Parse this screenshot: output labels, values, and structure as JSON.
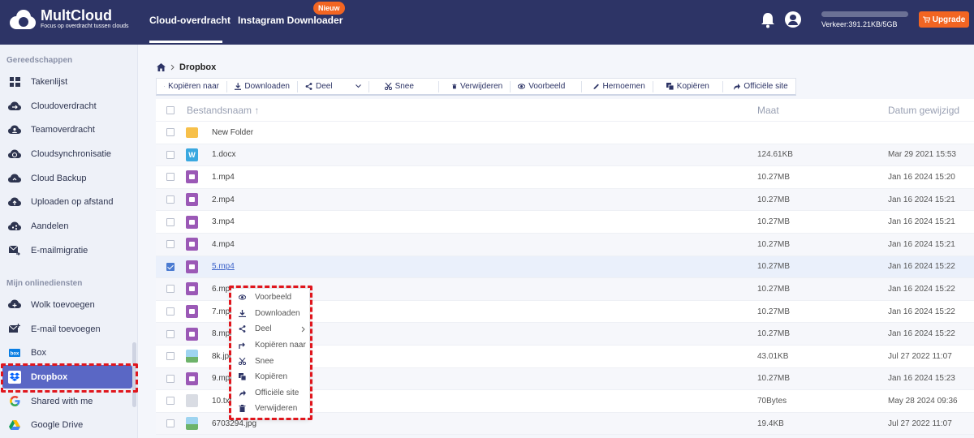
{
  "header": {
    "logo_name": "MultCloud",
    "logo_sub": "Focus op overdracht tussen clouds",
    "nav": [
      "Cloud-overdracht",
      "Instagram Downloader"
    ],
    "badge_new": "Nieuw",
    "traffic_text": "Verkeer:391.21KB/5GB",
    "traffic_fraction": 0.0001,
    "upgrade_label": "Upgrade",
    "accent_color": "#f26522",
    "header_color": "#2d3466"
  },
  "sidebar": {
    "section_tools": "Gereedschappen",
    "tools": [
      "Takenlijst",
      "Cloudoverdracht",
      "Teamoverdracht",
      "Cloudsynchronisatie",
      "Cloud Backup",
      "Uploaden op afstand",
      "Aandelen",
      "E-mailmigratie"
    ],
    "section_services": "Mijn onlinediensten",
    "services": [
      "Wolk toevoegen",
      "E-mail toevoegen",
      "Box",
      "Dropbox",
      "Shared with me",
      "Google Drive"
    ],
    "active_item": "Dropbox",
    "active_color": "#5a67c5"
  },
  "breadcrumb": {
    "current": "Dropbox"
  },
  "toolbar": [
    "Kopiëren naar",
    "Downloaden",
    "Deel",
    "Snee",
    "Verwijderen",
    "Voorbeeld",
    "Hernoemen",
    "Kopiëren",
    "Officiële site"
  ],
  "table": {
    "headers": {
      "name": "Bestandsnaam",
      "size": "Maat",
      "date": "Datum gewijzigd"
    },
    "rows": [
      {
        "name": "New Folder",
        "size": "",
        "date": "",
        "icon": "folder-icon"
      },
      {
        "name": "1.docx",
        "size": "124.61KB",
        "date": "Mar 29 2021 15:53",
        "icon": "word-icon"
      },
      {
        "name": "1.mp4",
        "size": "10.27MB",
        "date": "Jan 16 2024 15:20",
        "icon": "video-icon"
      },
      {
        "name": "2.mp4",
        "size": "10.27MB",
        "date": "Jan 16 2024 15:21",
        "icon": "video-icon"
      },
      {
        "name": "3.mp4",
        "size": "10.27MB",
        "date": "Jan 16 2024 15:21",
        "icon": "video-icon"
      },
      {
        "name": "4.mp4",
        "size": "10.27MB",
        "date": "Jan 16 2024 15:21",
        "icon": "video-icon"
      },
      {
        "name": "5.mp4",
        "size": "10.27MB",
        "date": "Jan 16 2024 15:22",
        "icon": "video-icon",
        "selected": true
      },
      {
        "name": "6.mp4",
        "size": "10.27MB",
        "date": "Jan 16 2024 15:22",
        "icon": "video-icon"
      },
      {
        "name": "7.mp4",
        "size": "10.27MB",
        "date": "Jan 16 2024 15:22",
        "icon": "video-icon"
      },
      {
        "name": "8.mp4",
        "size": "10.27MB",
        "date": "Jan 16 2024 15:22",
        "icon": "video-icon"
      },
      {
        "name": "8k.jpg",
        "size": "43.01KB",
        "date": "Jul 27 2022 11:07",
        "icon": "image-icon"
      },
      {
        "name": "9.mp4",
        "size": "10.27MB",
        "date": "Jan 16 2024 15:23",
        "icon": "video-icon"
      },
      {
        "name": "10.txt",
        "size": "70Bytes",
        "date": "May 28 2024 09:36",
        "icon": "text-icon"
      },
      {
        "name": "6703294.jpg",
        "size": "19.4KB",
        "date": "Jul 27 2022 11:07",
        "icon": "image-icon"
      }
    ]
  },
  "context_menu": [
    "Voorbeeld",
    "Downloaden",
    "Deel",
    "Kopiëren naar",
    "Snee",
    "Kopiëren",
    "Officiële site",
    "Verwijderen"
  ]
}
